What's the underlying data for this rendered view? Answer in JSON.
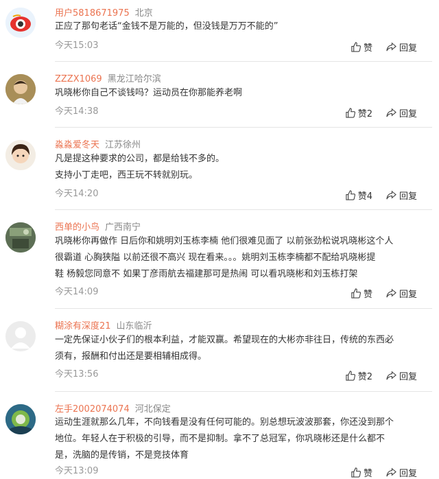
{
  "reply_label": "回复",
  "comments": [
    {
      "username": "用户5818671975",
      "location": "北京",
      "lines": [
        "正应了那句老话“金钱不是万能的，但没钱是万万不能的”"
      ],
      "time": "今天15:03",
      "like_label": "赞"
    },
    {
      "username": "ZZZX1069",
      "location": "黑龙江哈尔滨",
      "lines": [
        "巩晓彬你自己不谈钱吗？运动员在你那能养老啊"
      ],
      "time": "今天14:38",
      "like_label": "赞2"
    },
    {
      "username": "淼淼爱冬天",
      "location": "江苏徐州",
      "lines": [
        "凡是提这种要求的公司，都是给钱不多的。",
        "支持小丁走吧，西王玩不转就别玩。"
      ],
      "time": "今天14:20",
      "like_label": "赞4"
    },
    {
      "username": "西单的小鸟",
      "location": "广西南宁",
      "lines": [
        "巩晓彬你再做作 日后你和姚明刘玉栋李楠 他们很难见面了 以前张劲松说巩晓彬这个人",
        "很霸道 心胸狭隘 以前还很不高兴 现在看来。。。姚明刘玉栋李楠都不配给巩晓彬提",
        "鞋 杨毅您同意不 如果丁彦雨航去福建那可是热闹 可以看巩晓彬和刘玉栋打架"
      ],
      "time": "今天14:09",
      "like_label": "赞"
    },
    {
      "username": "糊涂有深度21",
      "location": "山东临沂",
      "lines": [
        "一定先保证小伙子们的根本利益，才能双赢。希望现在的大彬亦非往日，传统的东西必",
        "须有，报酬和付出还是要相辅相成得。"
      ],
      "time": "今天13:56",
      "like_label": "赞2"
    },
    {
      "username": "左手2002074074",
      "location": "河北保定",
      "lines": [
        "运动生涯就那么几年，不向钱看是没有任何可能的。别总想玩波波那套，你还没到那个",
        "地位。年轻人在于积极的引导，而不是抑制。拿不了总冠军，你巩晓彬还是什么都不",
        "是，洗脑的是传销，不是竞技体育"
      ],
      "time": "今天13:09",
      "like_label": "赞"
    }
  ]
}
